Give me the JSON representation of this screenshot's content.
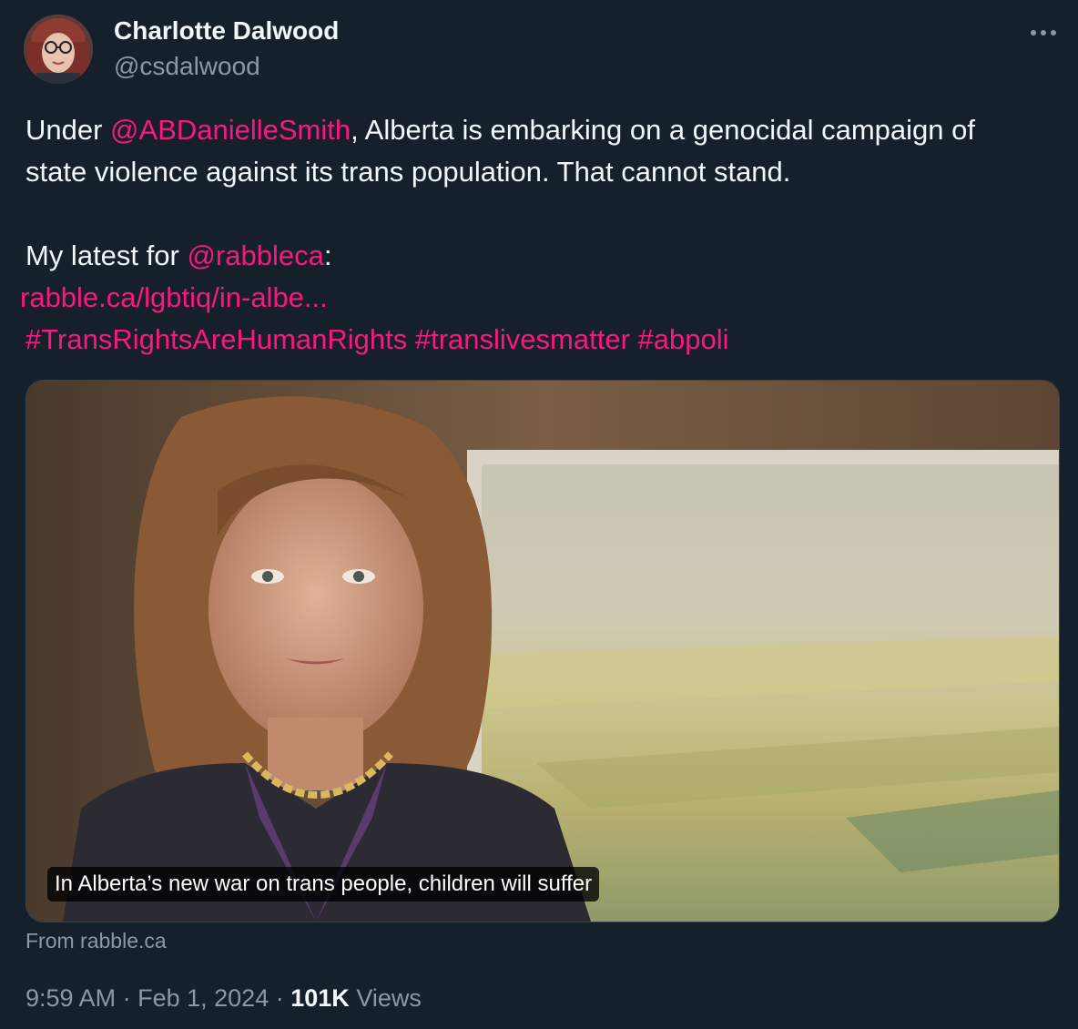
{
  "author": {
    "name": "Charlotte Dalwood",
    "handle": "@csdalwood"
  },
  "menu_icon": "more-horizontal-icon",
  "tweet": {
    "line1": {
      "pre": "Under ",
      "mention": "@ABDanielleSmith",
      "post": ", Alberta is embarking on a genocidal campaign of"
    },
    "line2": "state violence against its trans population. That cannot stand.",
    "line3": {
      "pre": "My latest for ",
      "mention": "@rabbleca",
      "post": ":"
    },
    "link": "rabble.ca/lgbtiq/in-albe...",
    "hashtags": [
      "#TransRightsAreHumanRights",
      "#translivesmatter",
      "#abpoli"
    ]
  },
  "media": {
    "caption": "In Alberta’s new war on trans people, children will suffer",
    "source": "From rabble.ca"
  },
  "meta": {
    "time": "9:59 AM",
    "sep1": "·",
    "date": "Feb 1, 2024",
    "sep2": "·",
    "views_count": "101K",
    "views_label": "Views"
  },
  "colors": {
    "background": "#15202b",
    "accent": "#f91880",
    "secondary_text": "#8b98a5",
    "primary_text": "#f5f8fa"
  }
}
